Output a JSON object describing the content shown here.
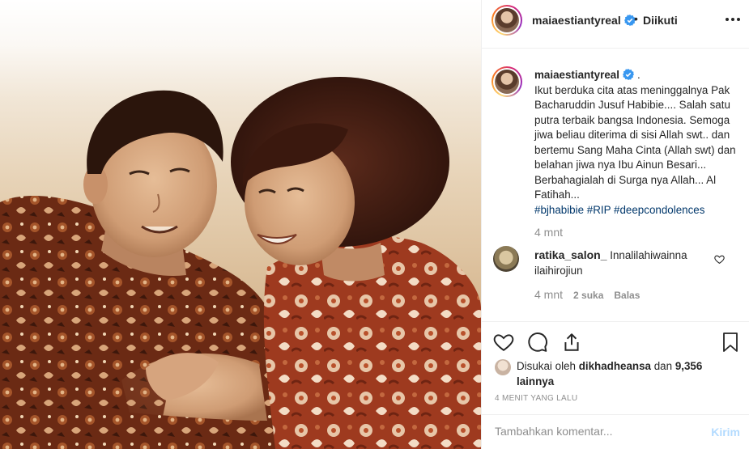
{
  "post": {
    "author": "maiaestiantyreal",
    "follow_status": "Diikuti",
    "separator": "•",
    "photo_alt": "Foto Pak Bacharuddin Jusuf Habibie dan Ibu Ainun Besari"
  },
  "caption": {
    "username": "maiaestiantyreal",
    "suffix": ".",
    "text": "Ikut berduka cita atas meninggalnya Pak Bacharuddin Jusuf Habibie.... Salah satu putra terbaik bangsa Indonesia. Semoga jiwa beliau diterima di sisi Allah swt.. dan bertemu Sang Maha Cinta (Allah swt) dan belahan jiwa nya Ibu Ainun Besari... Berbahagialah di Surga nya Allah... Al Fatihah...",
    "hashtags": "#bjhabibie #RIP #deepcondolences",
    "time": "4 mnt"
  },
  "comment": {
    "username": "ratika_salon_",
    "text": "Innalilahiwainna ilaihirojiun",
    "time": "4 mnt",
    "likes": "2 suka",
    "reply": "Balas"
  },
  "likes": {
    "prefix": "Disukai oleh",
    "user": "dikhadheansa",
    "and": "dan",
    "others": "9,356 lainnya"
  },
  "age": "4 MENIT YANG LALU",
  "composer": {
    "placeholder": "Tambahkan komentar...",
    "post_label": "Kirim"
  },
  "colors": {
    "verified": "#3897f0",
    "hashtag": "#00376b",
    "muted": "#8e8e8e",
    "post_disabled": "#b3dbff"
  },
  "icons": {
    "header_more": "more-horizontal-icon",
    "verified": "verified-badge-icon",
    "like": "heart-icon",
    "comment": "comment-icon",
    "share": "share-icon",
    "save": "bookmark-icon",
    "comment_like": "small-heart-icon"
  }
}
